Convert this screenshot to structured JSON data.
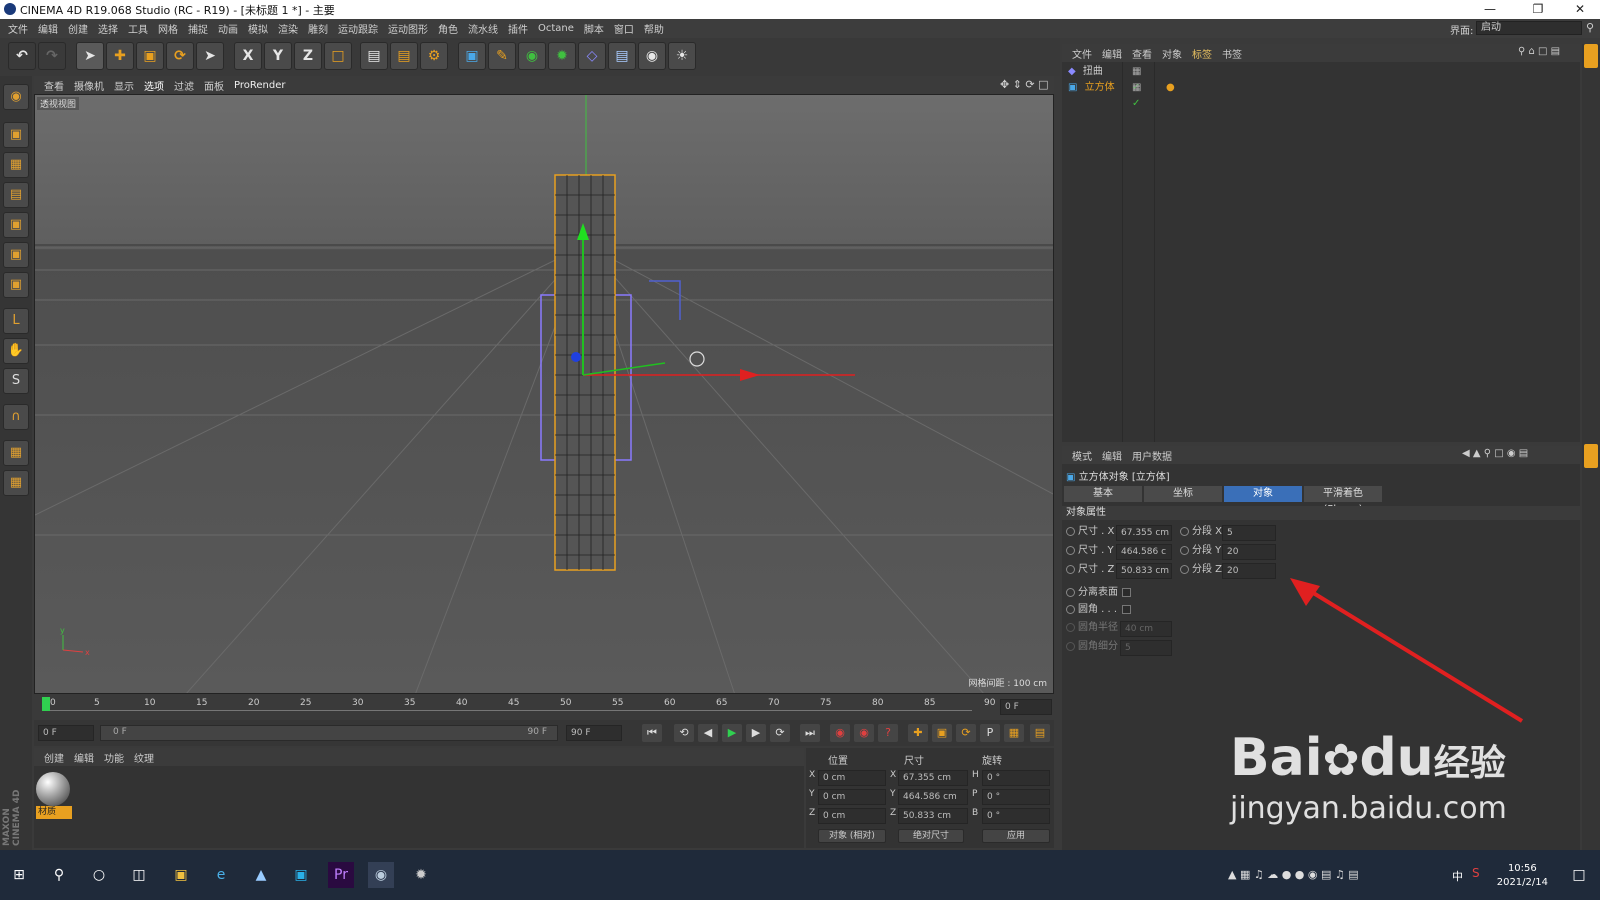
{
  "window": {
    "title": "CINEMA 4D R19.068 Studio (RC - R19) - [未标题 1 *] - 主要"
  },
  "menu": [
    "文件",
    "编辑",
    "创建",
    "选择",
    "工具",
    "网格",
    "捕捉",
    "动画",
    "模拟",
    "渲染",
    "雕刻",
    "运动跟踪",
    "运动图形",
    "角色",
    "流水线",
    "插件",
    "Octane",
    "脚本",
    "窗口",
    "帮助"
  ],
  "layout": {
    "label": "界面:",
    "value": "启动"
  },
  "viewport": {
    "menu": [
      "查看",
      "摄像机",
      "显示",
      "选项",
      "过滤",
      "面板",
      "ProRender"
    ],
    "label": "透视视图",
    "grid_info": "网格间距 : 100 cm"
  },
  "timeline": {
    "ticks": [
      "0",
      "5",
      "10",
      "15",
      "20",
      "25",
      "30",
      "35",
      "40",
      "45",
      "50",
      "55",
      "60",
      "65",
      "70",
      "75",
      "80",
      "85",
      "90"
    ],
    "current_frame": "0 F",
    "start": "0 F",
    "range_start": "0 F",
    "range_end": "90 F",
    "end": "90 F"
  },
  "material_panel": {
    "menu": [
      "创建",
      "编辑",
      "功能",
      "纹理"
    ],
    "material_name": "材质"
  },
  "coord_panel": {
    "headers": [
      "位置",
      "尺寸",
      "旋转"
    ],
    "pos": [
      "0 cm",
      "0 cm",
      "0 cm"
    ],
    "size": [
      "67.355 cm",
      "464.586 cm",
      "50.833 cm"
    ],
    "rot": [
      "0 °",
      "0 °",
      "0 °"
    ],
    "axes_pos": [
      "X",
      "Y",
      "Z"
    ],
    "axes_rot": [
      "H",
      "P",
      "B"
    ],
    "mode1": "对象 (相对)",
    "mode2": "绝对尺寸",
    "apply": "应用"
  },
  "object_manager": {
    "menu": [
      "文件",
      "编辑",
      "查看",
      "对象",
      "标签",
      "书签"
    ],
    "objects": [
      "扭曲",
      "立方体"
    ]
  },
  "attr_manager": {
    "menu": [
      "模式",
      "编辑",
      "用户数据"
    ],
    "title": "立方体对象 [立方体]",
    "tabs": [
      "基本",
      "坐标",
      "对象",
      "平滑着色(Phong)"
    ],
    "section": "对象属性",
    "size_x_label": "尺寸 . X",
    "size_x": "67.355 cm",
    "size_y_label": "尺寸 . Y",
    "size_y": "464.586 c",
    "size_z_label": "尺寸 . Z",
    "size_z": "50.833 cm",
    "seg_x_label": "分段 X",
    "seg_x": "5",
    "seg_y_label": "分段 Y",
    "seg_y": "20",
    "seg_z_label": "分段 Z",
    "seg_z": "20",
    "sep_surface": "分离表面",
    "fillet": "圆角 . . .",
    "fillet_radius_label": "圆角半径",
    "fillet_radius": "40 cm",
    "fillet_sub_label": "圆角细分",
    "fillet_sub": "5"
  },
  "taskbar": {
    "time": "10:56",
    "date": "2021/2/14",
    "ime": "中"
  },
  "watermark": {
    "brand": "Bai",
    "du": "du",
    "suffix": "经验",
    "url": "jingyan.baidu.com"
  },
  "colors": {
    "accent": "#3a6fb8",
    "orange": "#e8a020",
    "axis_x": "#e02020",
    "axis_y": "#20c020",
    "axis_z": "#2040e0"
  }
}
